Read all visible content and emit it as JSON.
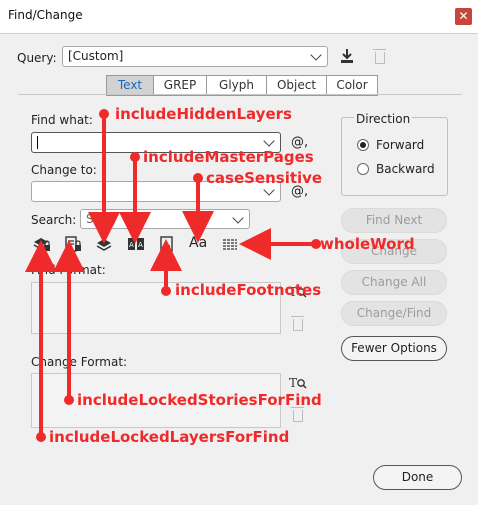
{
  "window": {
    "title": "Find/Change",
    "close_icon": "close-icon"
  },
  "query": {
    "label": "Query:",
    "value": "[Custom]"
  },
  "tabs": [
    {
      "label": "Text",
      "active": true
    },
    {
      "label": "GREP",
      "active": false
    },
    {
      "label": "Glyph",
      "active": false
    },
    {
      "label": "Object",
      "active": false
    },
    {
      "label": "Color",
      "active": false
    }
  ],
  "find_what": {
    "label": "Find what:",
    "value": ""
  },
  "change_to": {
    "label": "Change to:",
    "value": ""
  },
  "search": {
    "label": "Search:",
    "value": "Story"
  },
  "direction": {
    "label": "Direction",
    "forward": "Forward",
    "backward": "Backward",
    "selected": "Forward"
  },
  "buttons": {
    "find_next": "Find Next",
    "change": "Change",
    "change_all": "Change All",
    "change_find": "Change/Find",
    "fewer_options": "Fewer Options",
    "done": "Done"
  },
  "find_format": {
    "label": "Find Format:"
  },
  "change_format": {
    "label": "Change Format:"
  },
  "options_icons": [
    "locked-layers-icon",
    "locked-stories-icon",
    "hidden-layers-icon",
    "master-pages-icon",
    "footnotes-icon",
    "case-sensitive-icon",
    "whole-word-icon"
  ],
  "case_glyph": "Aa",
  "at_symbol": "@,",
  "annotations": {
    "includeHiddenLayers": "includeHiddenLayers",
    "includeMasterPages": "includeMasterPages",
    "caseSensitive": "caseSensitive",
    "wholeWord": "wholeWord",
    "includeFootnotes": "includeFootnotes",
    "includeLockedStoriesForFind": "includeLockedStoriesForFind",
    "includeLockedLayersForFind": "includeLockedLayersForFind"
  },
  "colors": {
    "annotation": "#ee2a2a",
    "active_tab_text": "#1a6ab8",
    "close": "#c7453d"
  }
}
